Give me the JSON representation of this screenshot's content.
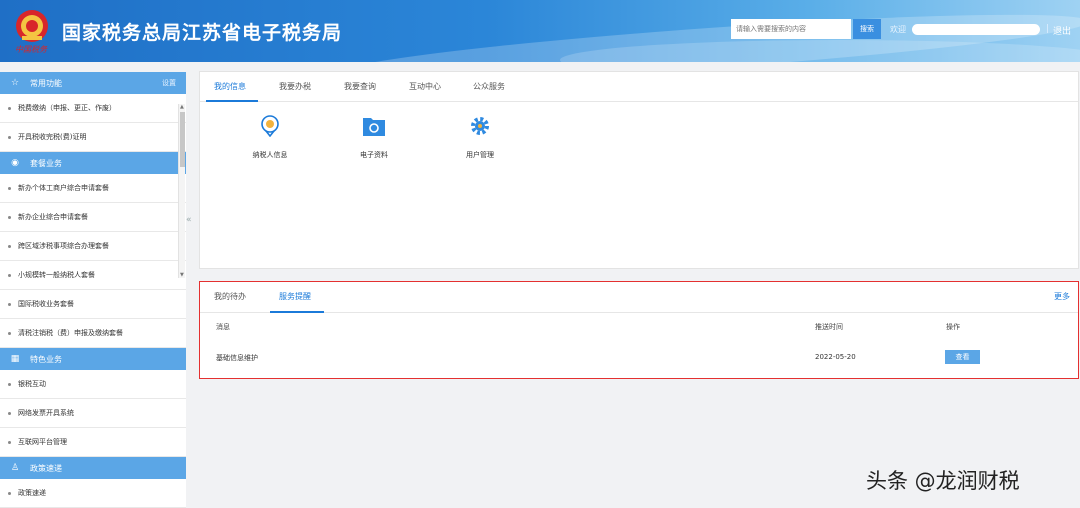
{
  "header": {
    "seal_text": "中国税务",
    "title": "国家税务总局江苏省电子税务局",
    "search_placeholder": "请输入需要搜索的内容",
    "search_button": "搜索",
    "welcome": "欢迎",
    "separator": "|",
    "logout": "退出"
  },
  "sidebar": {
    "sections": [
      {
        "title": "常用功能",
        "icon": "star-icon",
        "action": "设置",
        "items": [
          "税费缴纳（申报、更正、作废）",
          "开具税收完税(费)证明"
        ]
      },
      {
        "title": "套餐业务",
        "icon": "stack-icon",
        "items": [
          "新办个体工商户综合申请套餐",
          "新办企业综合申请套餐",
          "跨区域涉税事项综合办理套餐",
          "小规模转一般纳税人套餐",
          "国际税收业务套餐",
          "清税注销税（费）申报及缴纳套餐"
        ]
      },
      {
        "title": "特色业务",
        "icon": "grid-icon",
        "items": [
          "银税互动",
          "网络发票开具系统",
          "互联网平台管理"
        ]
      },
      {
        "title": "政策速递",
        "icon": "user-icon",
        "items": [
          "政策速递"
        ]
      }
    ]
  },
  "top_panel": {
    "tabs": [
      "我的信息",
      "我要办税",
      "我要查询",
      "互动中心",
      "公众服务"
    ],
    "active_tab": 0,
    "icons": [
      {
        "label": "纳税人信息",
        "icon": "taxpayer-info-icon"
      },
      {
        "label": "电子资料",
        "icon": "folder-icon"
      },
      {
        "label": "用户管理",
        "icon": "gear-icon"
      }
    ]
  },
  "bottom_panel": {
    "tabs": [
      "我的待办",
      "服务提醒"
    ],
    "active_tab": 1,
    "more": "更多",
    "columns": [
      "消息",
      "推送时间",
      "操作"
    ],
    "rows": [
      {
        "message": "基础信息维护",
        "time": "2022-05-20",
        "action": "查看"
      }
    ]
  },
  "watermark": "头条 @龙润财税",
  "colors": {
    "brand_blue": "#1b7ad9",
    "section_blue": "#5ba6e6",
    "highlight_red": "#e43030"
  }
}
